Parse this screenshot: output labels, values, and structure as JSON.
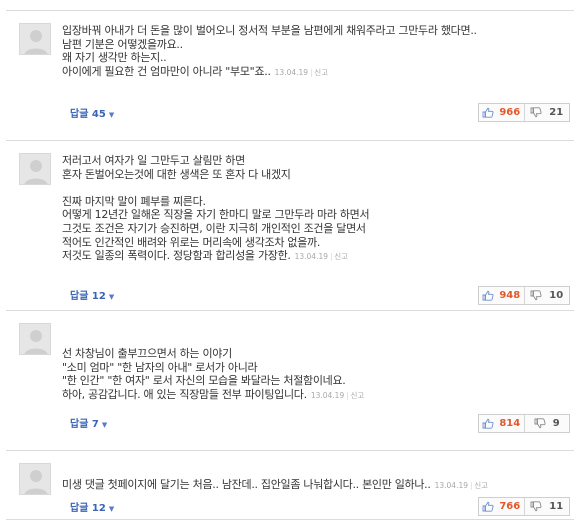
{
  "comments": [
    {
      "lines": [
        "입장바꿔 아내가 더 돈을 많이 벌어오니 정서적 부분을 남편에게 채워주라고 그만두라 했다면..",
        "남편 기분은 어떻겠을까요..",
        "왜 자기 생각만 하는지..",
        "아이에게 필요한 건 엄마만이 아니라 \"부모\"죠.."
      ],
      "date": "13.04.19",
      "report": "신고",
      "reply_label": "답글 45",
      "likes": "966",
      "dislikes": "21"
    },
    {
      "lines": [
        "저러고서 여자가 일 그만두고 살림만 하면",
        "혼자 돈벌어오는것에 대한 생색은 또 혼자 다 내겠지",
        "",
        "진짜 마지막 말이 폐부를 찌른다.",
        "어떻게 12년간 일해온 직장을 자기 한마디 말로 그만두라 마라 하면서",
        "그것도 조건은 자기가 승진하면, 이란 지극히 개인적인 조건을 달면서",
        "적어도 인간적인 배려와 위로는 머리속에 생각조차 없을까.",
        "저것도 일종의 폭력이다. 정당함과 합리성을 가장한."
      ],
      "date": "13.04.19",
      "report": "신고",
      "reply_label": "답글 12",
      "likes": "948",
      "dislikes": "10"
    },
    {
      "lines": [
        "선 차창님이 출부끄으면서 하는 이야기",
        "\"소미 엄마\" \"한 남자의 아내\" 로서가 아니라",
        "\"한 인간\" \"한 여자\" 로서 자신의 모습을 봐달라는 처절함이네요.",
        "하아, 공감갑니다. 애 있는 직장맘들 전부 파이팅입니다."
      ],
      "date": "13.04.19",
      "report": "신고",
      "reply_label": "답글 7",
      "likes": "814",
      "dislikes": "9"
    },
    {
      "lines": [
        "미생 댓글 첫페이지에 달기는 처음.. 남잔데.. 집안일좀 나눠합시다.. 본인만 일하나.."
      ],
      "date": "13.04.19",
      "report": "신고",
      "reply_label": "답글 12",
      "likes": "766",
      "dislikes": "11"
    }
  ],
  "icons": {
    "like": "thumbs-up-icon",
    "dislike": "thumbs-down-icon",
    "avatar": "default-avatar"
  },
  "colors": {
    "like_count": "#e3572b",
    "reply_link": "#3a64b8",
    "border": "#dcdcdc"
  }
}
